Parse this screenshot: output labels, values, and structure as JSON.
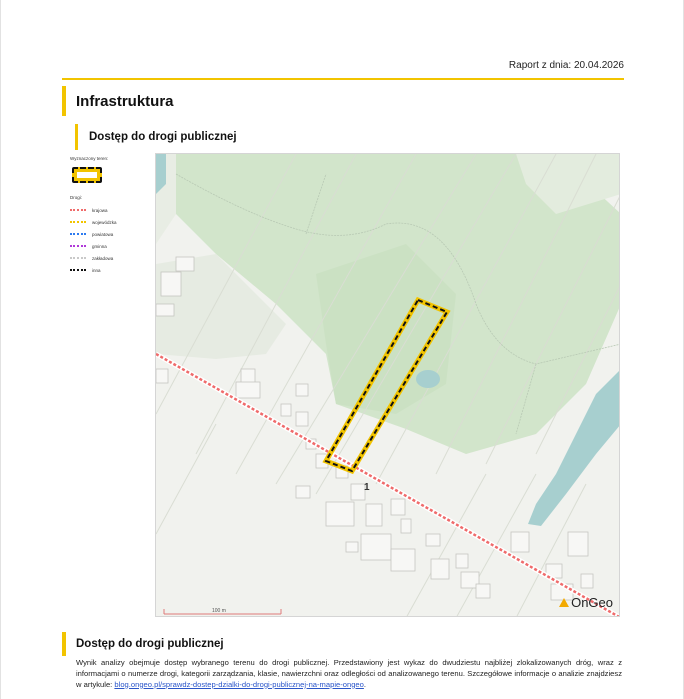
{
  "header": {
    "report_date": "Raport z dnia: 20.04.2026"
  },
  "section": {
    "title": "Infrastruktura",
    "subtitle": "Dostęp do drogi publicznej"
  },
  "legend": {
    "plot_title": "Wyznaczony teren:",
    "roads_title": "Drogi:",
    "roads": [
      {
        "label": "krajowa",
        "color": "#ef6b6b"
      },
      {
        "label": "wojewódzka",
        "color": "#f2c400"
      },
      {
        "label": "powiatowa",
        "color": "#2d7bf0"
      },
      {
        "label": "gminna",
        "color": "#b03ad9"
      },
      {
        "label": "zakładowa",
        "color": "#c9c9c9"
      },
      {
        "label": "inna",
        "color": "#111111"
      }
    ]
  },
  "map": {
    "road_number": "1",
    "scale_label": "100 m",
    "brand": "OnGeo",
    "colors": {
      "forest": "#cfe3c8",
      "field": "#f1f2ee",
      "water": "#a7cfcf",
      "road": "#ef6b6b",
      "plot_outline": "#f2c400"
    }
  },
  "description": {
    "title": "Dostęp do drogi publicznej",
    "text": "Wynik analizy obejmuje dostęp wybranego terenu do drogi publicznej. Przedstawiony jest wykaz do dwudziestu najbliżej zlokalizowanych dróg, wraz z informacjami o numerze drogi, kategorii zarządzania, klasie, nawierzchni oraz odległości od analizowanego terenu. Szczegółowe informacje o analizie znajdziesz w artykule: ",
    "link": "blog.ongeo.pl/sprawdz-dostep-dzialki-do-drogi-publicznej-na-mapie-ongeo",
    "after_link": "."
  }
}
